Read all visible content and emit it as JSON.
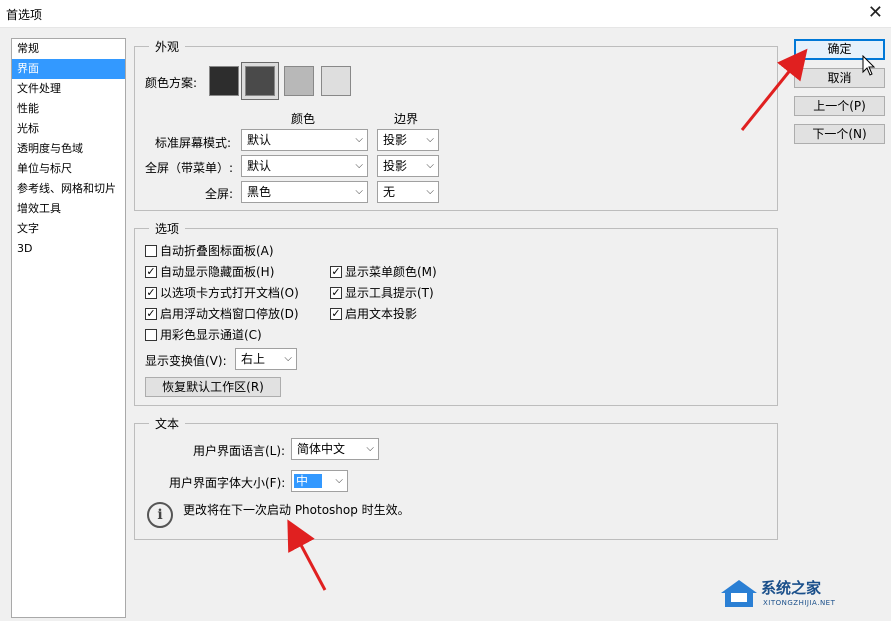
{
  "window": {
    "title": "首选项",
    "close_glyph": "✕"
  },
  "sidebar": {
    "items": [
      {
        "label": "常规",
        "selected": false
      },
      {
        "label": "界面",
        "selected": true
      },
      {
        "label": "文件处理",
        "selected": false
      },
      {
        "label": "性能",
        "selected": false
      },
      {
        "label": "光标",
        "selected": false
      },
      {
        "label": "透明度与色域",
        "selected": false
      },
      {
        "label": "单位与标尺",
        "selected": false
      },
      {
        "label": "参考线、网格和切片",
        "selected": false
      },
      {
        "label": "增效工具",
        "selected": false
      },
      {
        "label": "文字",
        "selected": false
      },
      {
        "label": "3D",
        "selected": false
      }
    ]
  },
  "appearance": {
    "legend": "外观",
    "color_scheme_label": "颜色方案:",
    "swatches": [
      "#2d2d2d",
      "#4a4a4a",
      "#b8b8b8",
      "#dedede"
    ],
    "col_color": "颜色",
    "col_border": "边界",
    "rows": [
      {
        "label": "标准屏幕模式:",
        "color": "默认",
        "border": "投影"
      },
      {
        "label": "全屏（带菜单）:",
        "color": "默认",
        "border": "投影"
      },
      {
        "label": "全屏:",
        "color": "黑色",
        "border": "无"
      }
    ]
  },
  "options": {
    "legend": "选项",
    "checkboxes": [
      {
        "label": "自动折叠图标面板(A)",
        "checked": false
      },
      {
        "label": "自动显示隐藏面板(H)",
        "checked": true
      },
      {
        "label": "以选项卡方式打开文档(O)",
        "checked": true
      },
      {
        "label": "启用浮动文档窗口停放(D)",
        "checked": true
      },
      {
        "label": "用彩色显示通道(C)",
        "checked": false
      },
      {
        "label": "显示菜单颜色(M)",
        "checked": true
      },
      {
        "label": "显示工具提示(T)",
        "checked": true
      },
      {
        "label": "启用文本投影",
        "checked": true
      }
    ],
    "transform_label": "显示变换值(V):",
    "transform_value": "右上",
    "reset_button": "恢复默认工作区(R)"
  },
  "text_section": {
    "legend": "文本",
    "ui_language_label": "用户界面语言(L):",
    "ui_language_value": "简体中文",
    "ui_font_size_label": "用户界面字体大小(F):",
    "ui_font_size_value": "中",
    "info_icon_glyph": "i",
    "info_message": "更改将在下一次启动 Photoshop 时生效。"
  },
  "buttons": {
    "ok": "确定",
    "cancel": "取消",
    "prev": "上一个(P)",
    "next": "下一个(N)"
  },
  "watermark": {
    "title": "系统之家",
    "subtitle": "XITONGZHIJIA.NET"
  },
  "colors": {
    "selection": "#3399ff",
    "annotation_arrow": "#e02020"
  }
}
